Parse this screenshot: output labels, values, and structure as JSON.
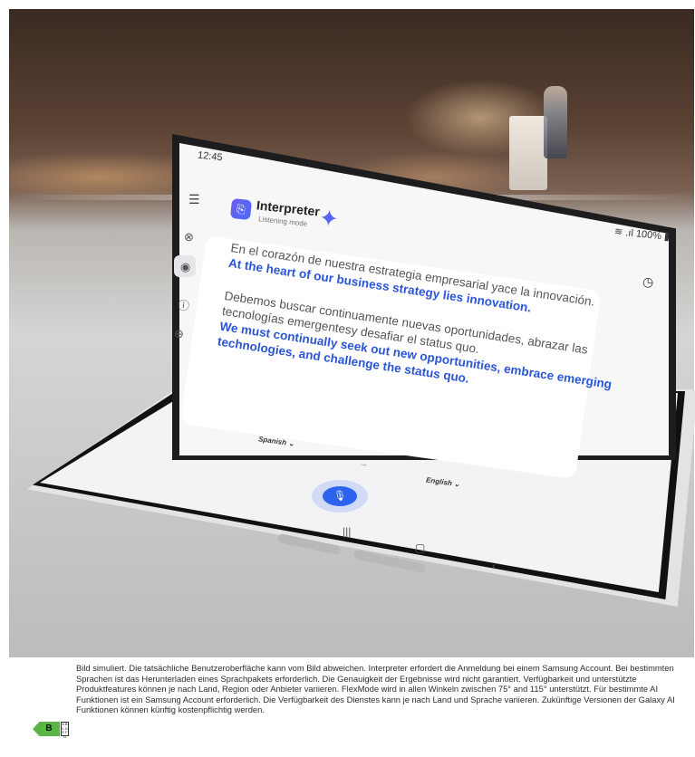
{
  "status": {
    "time": "12:45",
    "battery": "100%"
  },
  "app": {
    "title": "Interpreter",
    "subtitle": "Listening mode",
    "sparkle_icon": "sparkle-icon"
  },
  "conversation": [
    {
      "source": [
        "En el corazón de nuestra estrategia empresarial yace la innovación."
      ],
      "target": [
        "At the heart of our business strategy lies innovation."
      ]
    },
    {
      "source": [
        "Debemos buscar continuamente nuevas oportunidades, abrazar las",
        "tecnologías emergentesy desafiar el status quo."
      ],
      "target": [
        "We must continually seek out new opportunities, embrace emerging",
        "technologies, and challenge the status quo."
      ]
    }
  ],
  "languages": {
    "from": "Spanish",
    "to": "English",
    "caret": "⌄"
  },
  "disclaimer": "Bild simuliert. Die tatsächliche Benutzeroberfläche kann vom Bild abweichen. Interpreter erfordert die Anmeldung bei einem Samsung Account. Bei bestimmten Sprachen ist das Herunterladen eines Sprachpakets erforderlich. Die Genauigkeit der Ergebnisse wird nicht garantiert. Verfügbarkeit und unterstützte Produktfeatures können je nach Land, Region oder Anbieter variieren. FlexMode wird in allen Winkeln zwischen 75° and 115° unterstützt. Für bestimmte AI Funktionen ist ein Samsung Account erforderlich. Die Verfügbarkeit des Dienstes kann je nach Land und Sprache variieren. Zukünftige Versionen der Galaxy AI Funktionen können künftig kostenpflichtig werden.",
  "energy_label": {
    "class": "B",
    "scale": "A B C D E F G",
    "color": "#5bb546"
  },
  "colors": {
    "accent": "#2e63f0",
    "translation": "#2a55d8"
  }
}
